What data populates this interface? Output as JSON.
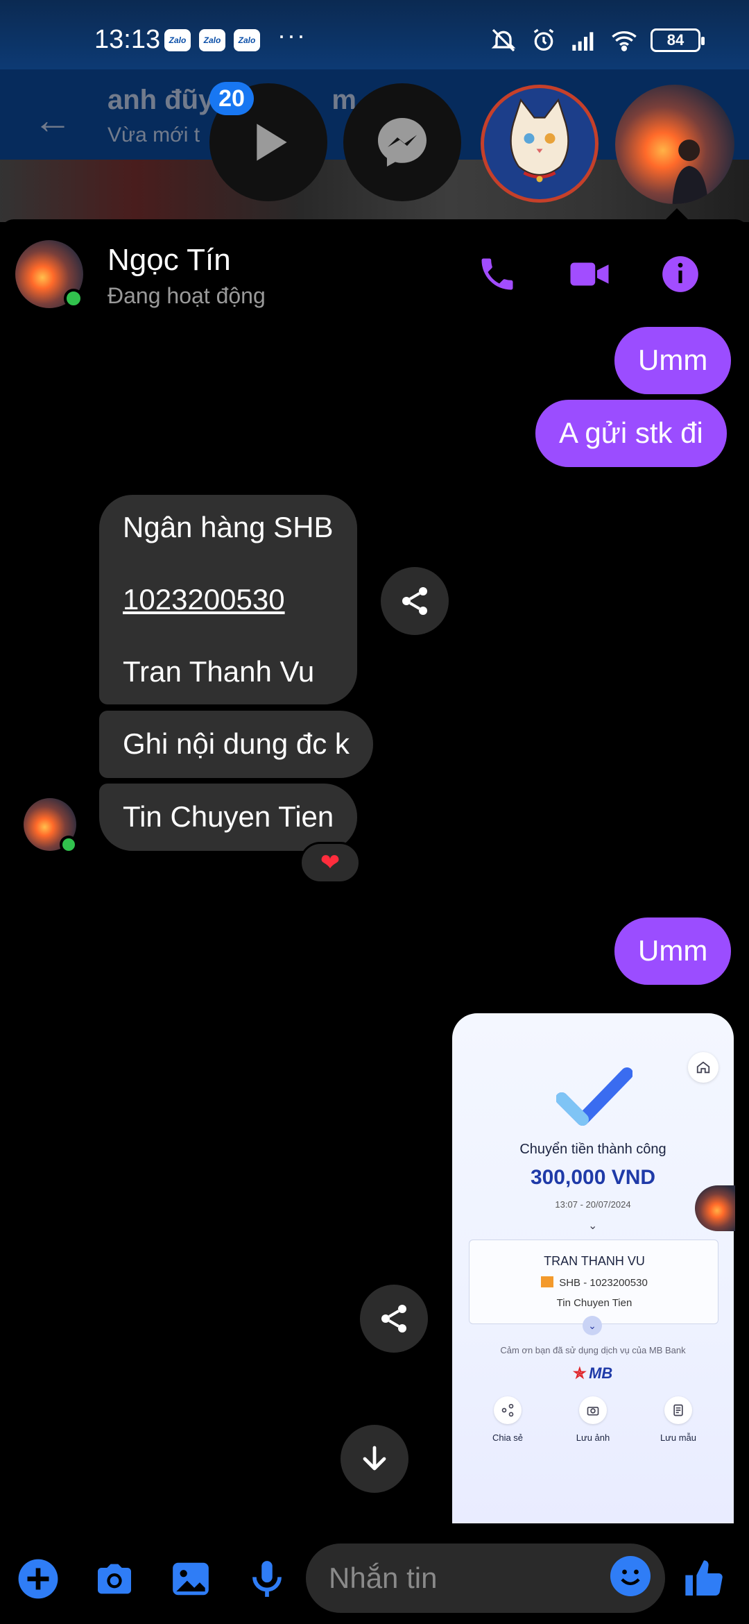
{
  "status_bar": {
    "time": "13:13",
    "notification_icons": [
      "Zalo",
      "Zalo",
      "Zalo"
    ],
    "more": "···",
    "battery": "84"
  },
  "underlying_app": {
    "title": "anh đũy",
    "title_tail": "m",
    "subtitle": "Vừa mới t"
  },
  "chat_heads": {
    "badge_count": "20"
  },
  "conversation": {
    "contact_name": "Ngọc Tín",
    "contact_status": "Đang hoạt động",
    "messages": {
      "out_1": "Umm",
      "out_2": "A gửi stk đi",
      "in_bank_line1": "Ngân hàng SHB",
      "in_bank_account": "1023200530",
      "in_bank_name": "Tran Thanh Vu",
      "in_2": "Ghi nội dung đc k",
      "in_3": "Tin Chuyen Tien",
      "out_3": "Umm"
    },
    "reaction": "❤"
  },
  "receipt": {
    "title": "Chuyển tiền thành công",
    "amount": "300,000 VND",
    "time": "13:07 - 20/07/2024",
    "recipient_name": "TRAN THANH VU",
    "recipient_bank": "SHB - 1023200530",
    "note": "Tin Chuyen Tien",
    "thanks": "Cảm ơn bạn đã sử dụng dịch vụ của MB Bank",
    "brand": "MB",
    "actions": [
      "Chia sẻ",
      "Lưu ảnh",
      "Lưu mẫu"
    ]
  },
  "composer": {
    "placeholder": "Nhắn tin"
  },
  "colors": {
    "accent": "#9b4dff",
    "incoming_bubble": "#303030",
    "online": "#31c24d",
    "composer_icons": "#2f7df6"
  }
}
